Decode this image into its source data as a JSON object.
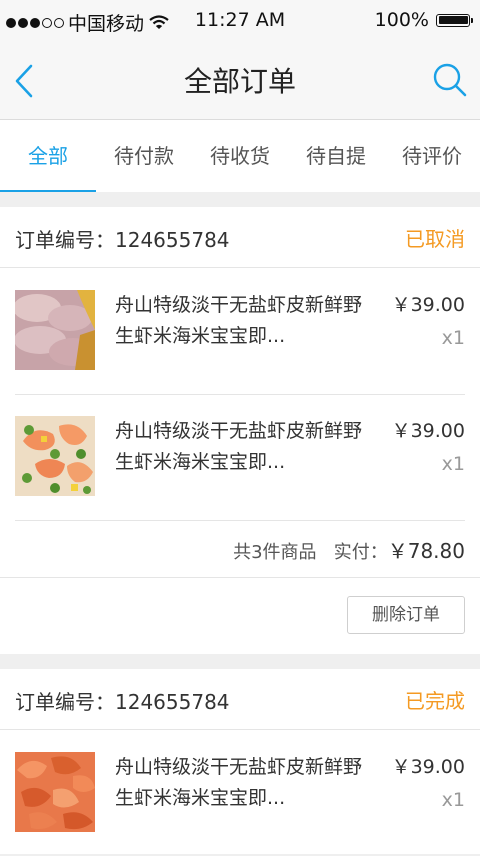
{
  "status_bar": {
    "carrier": "中国移动",
    "time": "11:27 AM",
    "battery": "100%"
  },
  "nav": {
    "title": "全部订单",
    "back_icon": "chevron-left-icon",
    "search_icon": "search-icon"
  },
  "tabs": [
    {
      "label": "全部",
      "active": true
    },
    {
      "label": "待付款"
    },
    {
      "label": "待收货"
    },
    {
      "label": "待自提"
    },
    {
      "label": "待评价"
    }
  ],
  "colors": {
    "accent": "#1aa1e6",
    "status": "#f49a23"
  },
  "orders": [
    {
      "number": "订单编号：124655784",
      "status": "已取消",
      "items": [
        {
          "title": "舟山特级淡干无盐虾皮新鲜野生虾米海米宝宝即...",
          "price": "￥39.00",
          "qty": "x1"
        },
        {
          "title": "舟山特级淡干无盐虾皮新鲜野生虾米海米宝宝即...",
          "price": "￥39.00",
          "qty": "x1"
        }
      ],
      "summary": {
        "count": "共3件商品",
        "paid_label": "实付：",
        "paid_value": "￥78.80"
      },
      "delete_label": "删除订单"
    },
    {
      "number": "订单编号：124655784",
      "status": "已完成",
      "items": [
        {
          "title": "舟山特级淡干无盐虾皮新鲜野生虾米海米宝宝即...",
          "price": "￥39.00",
          "qty": "x1"
        }
      ]
    }
  ]
}
